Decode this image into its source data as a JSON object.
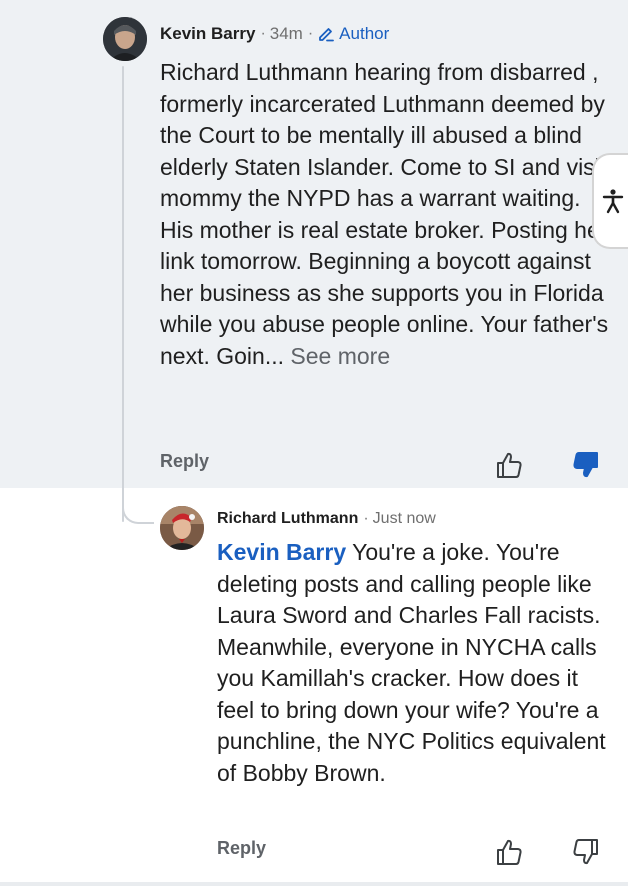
{
  "comments": [
    {
      "author": "Kevin Barry",
      "time": "34m",
      "badge": "Author",
      "text": "Richard Luthmann hearing from disbarred , formerly incarcerated Luthmann deemed by the Court to be mentally ill abused a blind elderly Staten Islander. Come to SI and visit mommy the NYPD has a warrant waiting. His mother  is real estate broker. Posting her link tomorrow. Beginning a boycott against her business as she supports you in Florida while you abuse people online. Your father's next. Goin...",
      "see_more": " See more",
      "reply_label": "Reply",
      "disliked": true
    },
    {
      "author": "Richard Luthmann",
      "time": "Just now",
      "mention": "Kevin Barry",
      "text": " You're a joke. You're deleting posts and calling people like Laura Sword and Charles Fall racists. Meanwhile, everyone in NYCHA calls you Kamillah's cracker. How does it feel to bring down your wife? You're a punchline, the NYC Politics equivalent of Bobby Brown.",
      "reply_label": "Reply",
      "disliked": false
    }
  ],
  "separator": "·",
  "colors": {
    "highlight_bg": "#eef1f4",
    "link_blue": "#1a5fc0",
    "muted": "#5f6368"
  },
  "icons": [
    "pencil-icon",
    "thumbs-up-icon",
    "thumbs-down-icon",
    "accessibility-icon"
  ]
}
